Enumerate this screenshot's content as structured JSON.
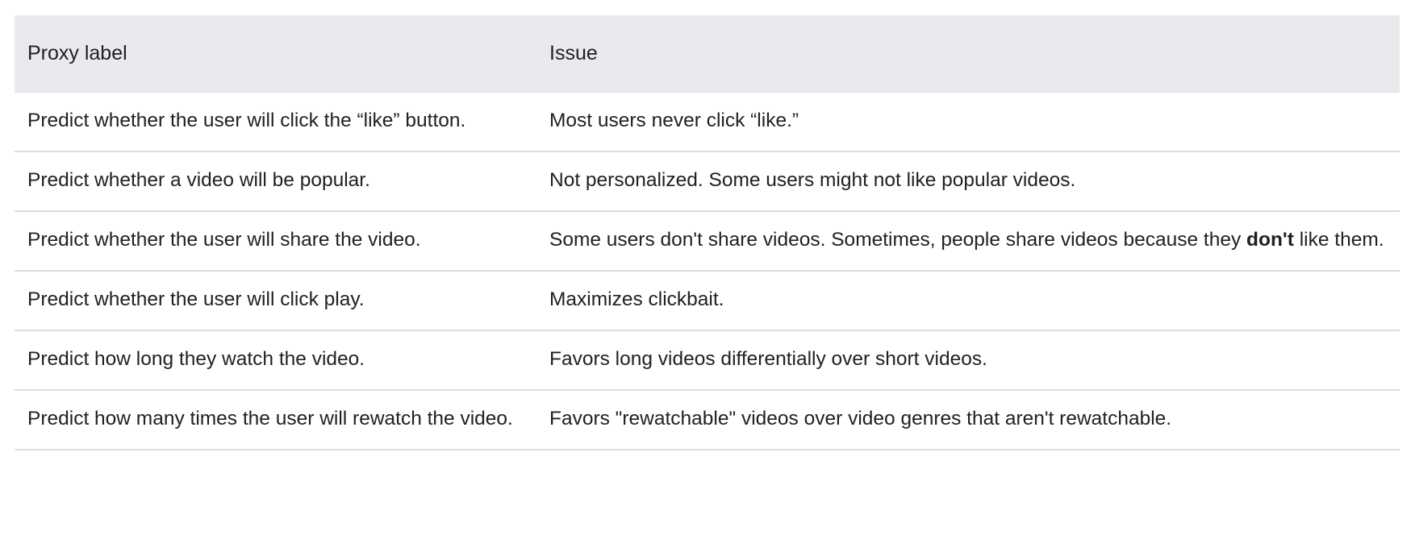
{
  "table": {
    "headers": {
      "proxy_label": "Proxy label",
      "issue": "Issue"
    },
    "rows": [
      {
        "proxy": "Predict whether the user will click the “like” button.",
        "issue": "Most users never click “like.”"
      },
      {
        "proxy": "Predict whether a video will be popular.",
        "issue": "Not personalized. Some users might not like popular videos."
      },
      {
        "proxy": "Predict whether the user will share the video.",
        "issue_before": "Some users don't share videos. Sometimes, people share videos because they ",
        "issue_bold": "don't",
        "issue_after": " like them."
      },
      {
        "proxy": "Predict whether the user will click play.",
        "issue": "Maximizes clickbait."
      },
      {
        "proxy": "Predict how long they watch the video.",
        "issue": "Favors long videos differentially over short videos."
      },
      {
        "proxy": "Predict how many times the user will rewatch the video.",
        "issue": "Favors \"rewatchable\" videos over video genres that aren't rewatchable."
      }
    ]
  },
  "colors": {
    "header_background": "#e8eaed",
    "row_divider": "#dadce0",
    "text": "#202124"
  }
}
